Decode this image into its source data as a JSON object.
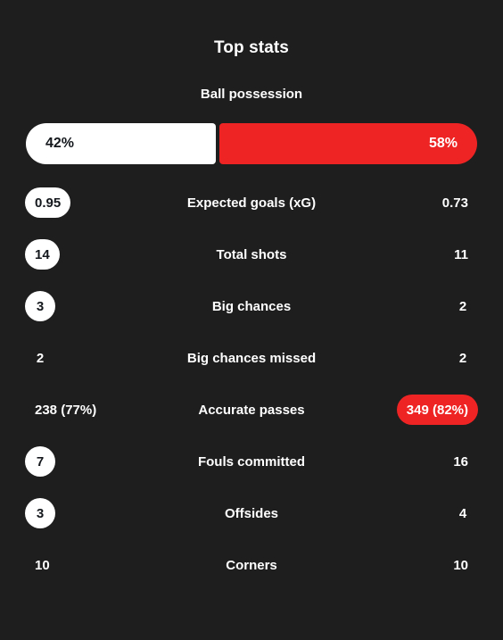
{
  "panel": {
    "title": "Top stats"
  },
  "possession": {
    "label": "Ball possession",
    "home_value": "42%",
    "away_value": "58%",
    "home_pct": 42,
    "away_pct": 58,
    "home_color": "#ffffff",
    "away_color": "#ee2424"
  },
  "colors": {
    "background": "#1e1e1e",
    "accent_red": "#ee2424",
    "highlight_white": "#ffffff",
    "pill_text_dark": "#14181c",
    "text": "#ffffff"
  },
  "stats": [
    {
      "label": "Expected goals (xG)",
      "home": "0.95",
      "away": "0.73",
      "home_highlight": "white",
      "away_highlight": "none"
    },
    {
      "label": "Total shots",
      "home": "14",
      "away": "11",
      "home_highlight": "white",
      "away_highlight": "none"
    },
    {
      "label": "Big chances",
      "home": "3",
      "away": "2",
      "home_highlight": "white",
      "away_highlight": "none"
    },
    {
      "label": "Big chances missed",
      "home": "2",
      "away": "2",
      "home_highlight": "none",
      "away_highlight": "none"
    },
    {
      "label": "Accurate passes",
      "home": "238 (77%)",
      "away": "349 (82%)",
      "home_highlight": "none",
      "away_highlight": "red"
    },
    {
      "label": "Fouls committed",
      "home": "7",
      "away": "16",
      "home_highlight": "white",
      "away_highlight": "none"
    },
    {
      "label": "Offsides",
      "home": "3",
      "away": "4",
      "home_highlight": "white",
      "away_highlight": "none"
    },
    {
      "label": "Corners",
      "home": "10",
      "away": "10",
      "home_highlight": "none",
      "away_highlight": "none"
    }
  ]
}
